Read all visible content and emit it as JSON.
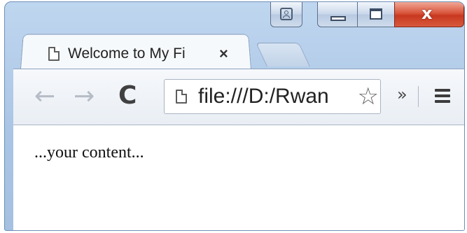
{
  "window": {
    "caption": {
      "profile_icon": "person-icon",
      "minimize_icon": "minimize-icon",
      "maximize_icon": "maximize-icon",
      "close_glyph": "x",
      "close_color": "#c7381f"
    }
  },
  "tabs": [
    {
      "title": "Welcome to My Fi",
      "close": "×",
      "icon": "document-icon",
      "active": true
    }
  ],
  "toolbar": {
    "back_glyph": "←",
    "forward_glyph": "→",
    "reload_glyph": "C",
    "url": "file:///D:/Rwan",
    "star_glyph": "☆",
    "overflow_glyph": "»",
    "menu_icon": "hamburger-menu-icon"
  },
  "page": {
    "text": "...your content..."
  }
}
